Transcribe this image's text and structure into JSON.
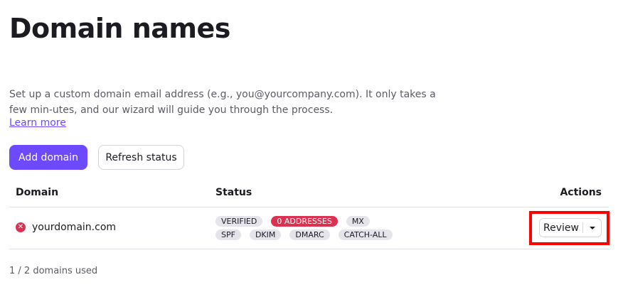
{
  "page": {
    "title": "Domain names",
    "intro": "Set up a custom domain email address (e.g., you@yourcompany.com). It only takes a few min-utes, and our wizard will guide you through the process.",
    "learn_more": "Learn more"
  },
  "toolbar": {
    "add_label": "Add domain",
    "refresh_label": "Refresh status"
  },
  "table": {
    "headers": {
      "domain": "Domain",
      "status": "Status",
      "actions": "Actions"
    },
    "rows": [
      {
        "domain": "yourdomain.com",
        "status_icon": "error-icon",
        "badges_row1": [
          "VERIFIED",
          "0 ADDRESSES",
          "MX"
        ],
        "badges_row2": [
          "SPF",
          "DKIM",
          "DMARC",
          "CATCH-ALL"
        ],
        "danger_badge": "0 ADDRESSES",
        "action_label": "Review"
      }
    ]
  },
  "footer": {
    "usage": "1 / 2 domains used"
  },
  "colors": {
    "accent": "#6d4aff",
    "danger": "#dc3251",
    "badge_bg": "#e5e4ea",
    "highlight": "#ff0000"
  }
}
